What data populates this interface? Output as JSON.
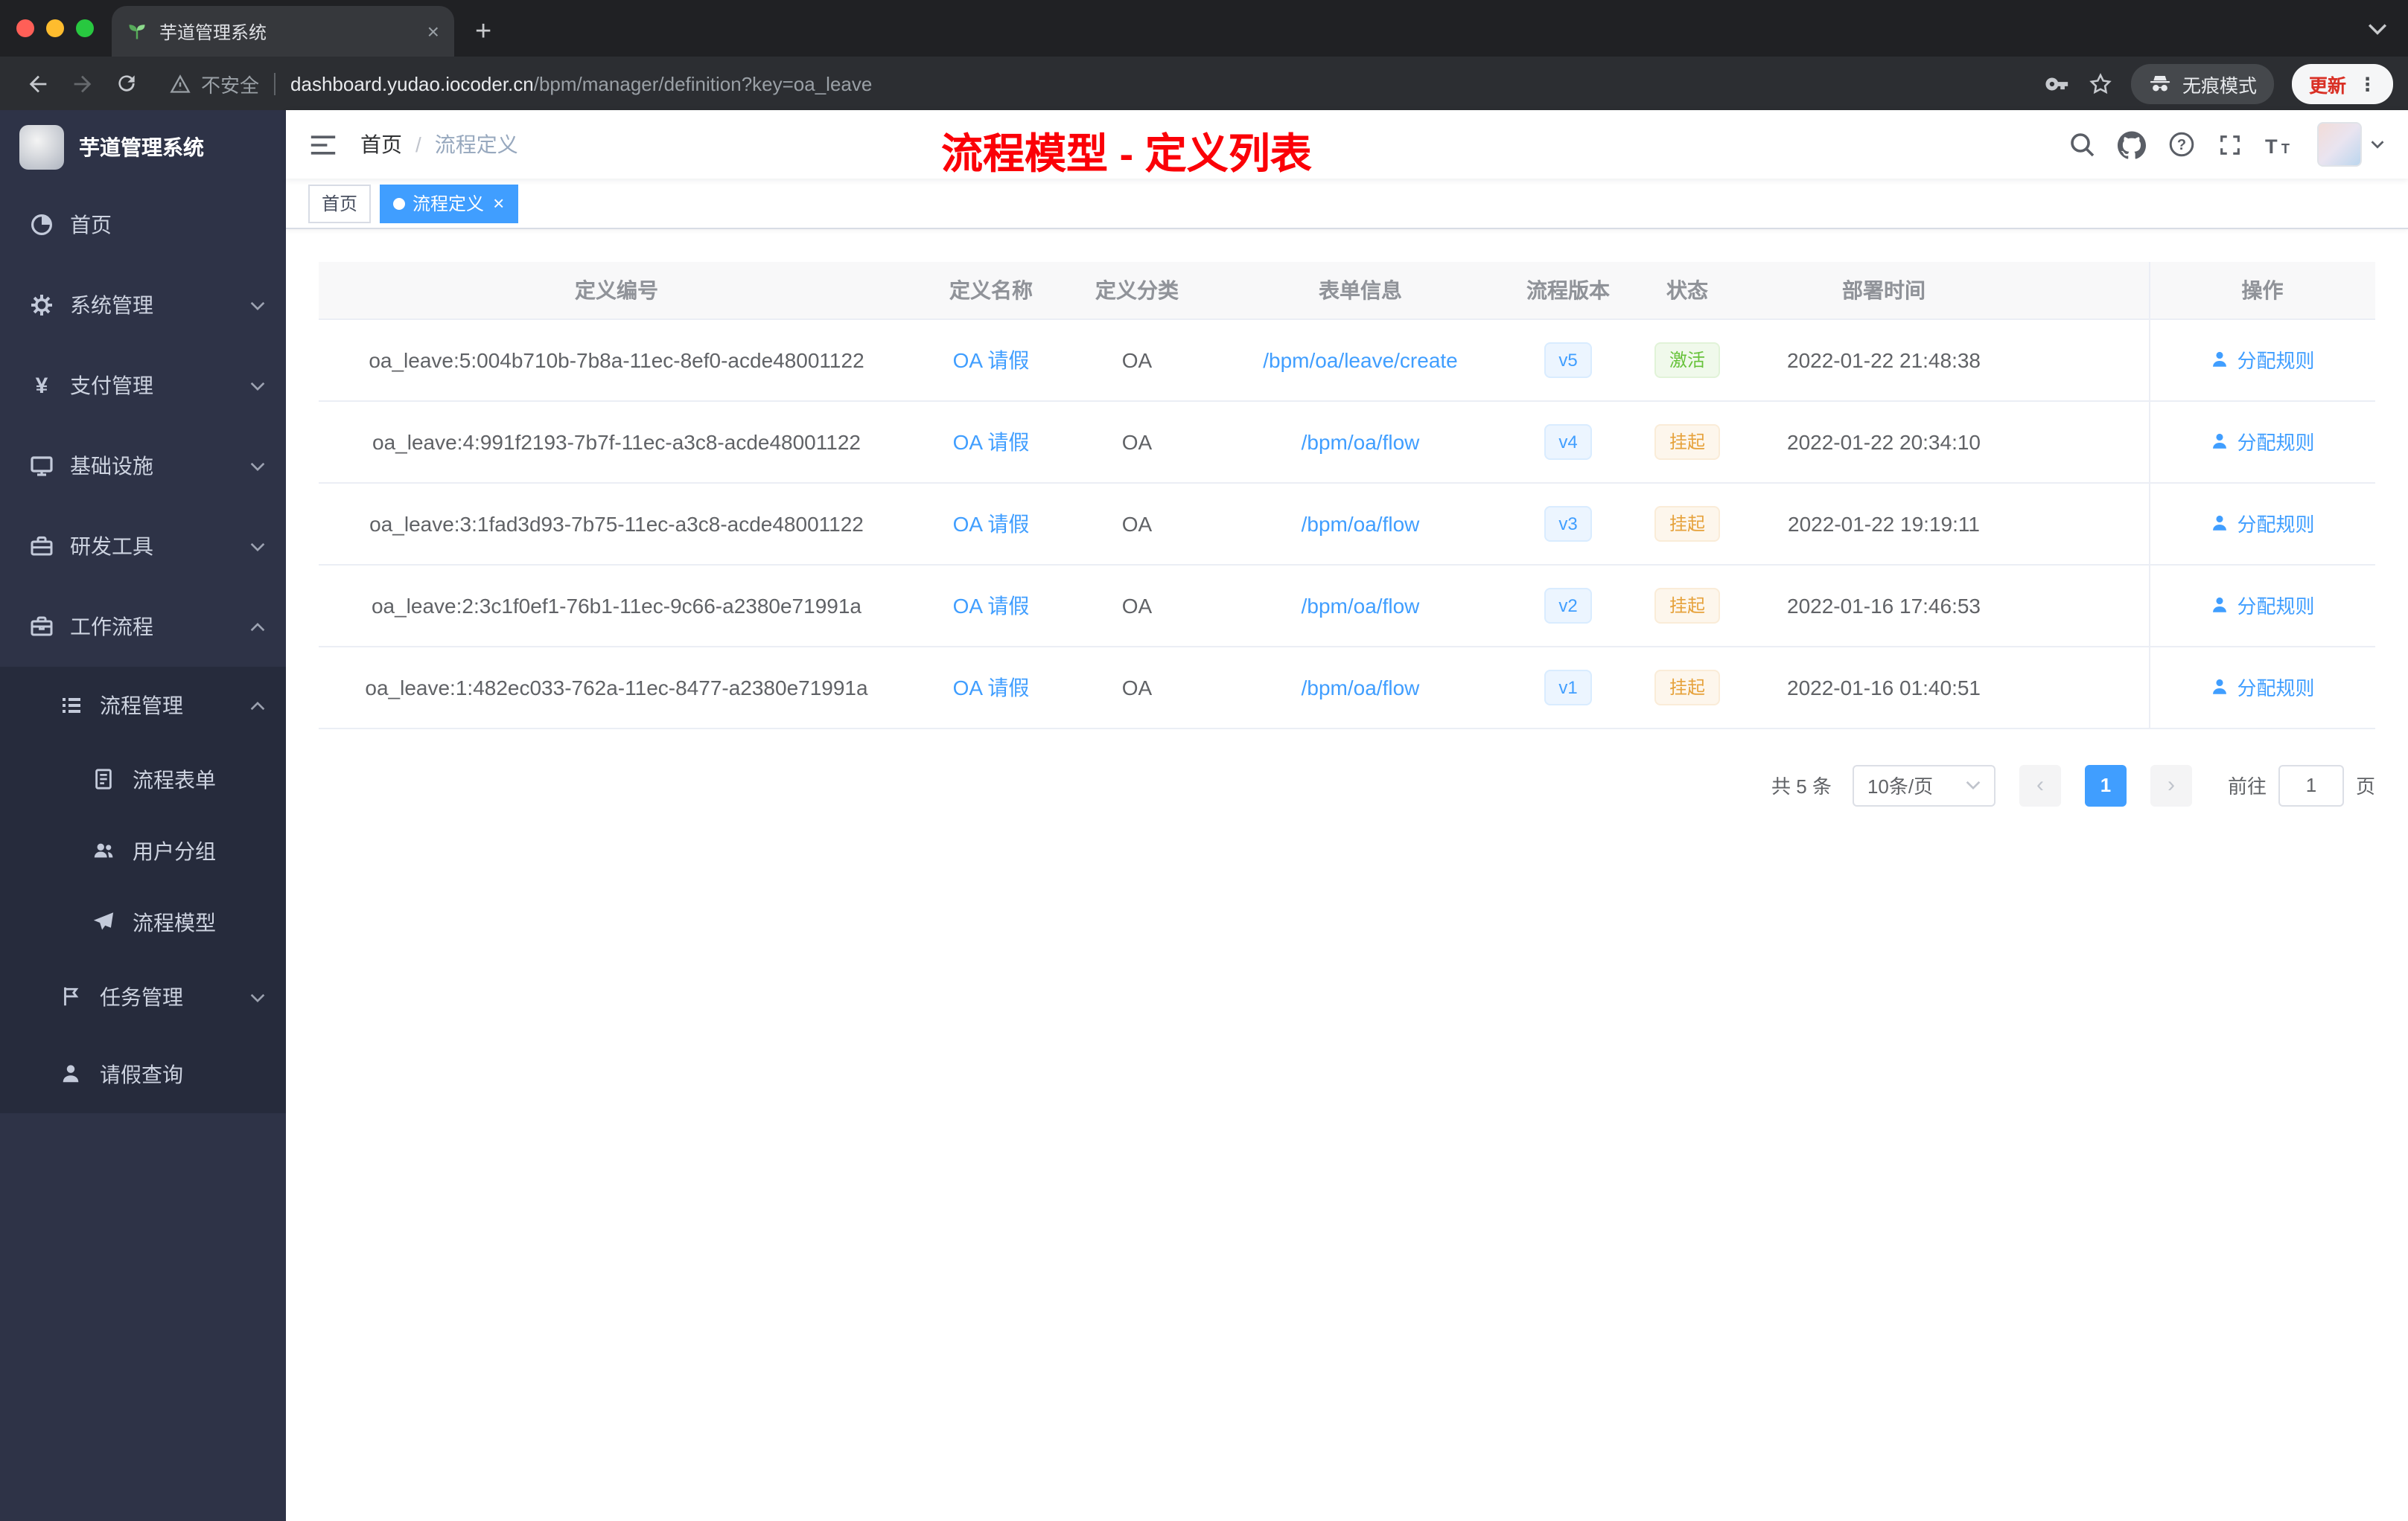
{
  "browser": {
    "tab_title": "芋道管理系统",
    "address": {
      "security_label": "不安全",
      "url_domain": "dashboard.yudao.iocoder.cn",
      "url_path": "/bpm/manager/definition?key=oa_leave",
      "incognito_label": "无痕模式",
      "update_label": "更新"
    }
  },
  "sidebar": {
    "logo_title": "芋道管理系统",
    "items": {
      "home": "首页",
      "system": "系统管理",
      "payment": "支付管理",
      "infra": "基础设施",
      "devtools": "研发工具",
      "workflow": "工作流程",
      "process_mgmt": "流程管理",
      "process_form": "流程表单",
      "user_group": "用户分组",
      "process_model": "流程模型",
      "task_mgmt": "任务管理",
      "leave_query": "请假查询"
    }
  },
  "header": {
    "breadcrumb_home": "首页",
    "breadcrumb_separator": "/",
    "breadcrumb_current": "流程定义",
    "annotation_title": "流程模型 - 定义列表"
  },
  "tags": {
    "home": "首页",
    "active": "流程定义"
  },
  "table": {
    "columns": [
      "定义编号",
      "定义名称",
      "定义分类",
      "表单信息",
      "流程版本",
      "状态",
      "部署时间",
      "操作"
    ],
    "rows": [
      {
        "id": "oa_leave:5:004b710b-7b8a-11ec-8ef0-acde48001122",
        "name": "OA 请假",
        "category": "OA",
        "form": "/bpm/oa/leave/create",
        "version": "v5",
        "status": "激活",
        "status_class": "badge badge-success",
        "time": "2022-01-22 21:48:38",
        "action": "分配规则"
      },
      {
        "id": "oa_leave:4:991f2193-7b7f-11ec-a3c8-acde48001122",
        "name": "OA 请假",
        "category": "OA",
        "form": "/bpm/oa/flow",
        "version": "v4",
        "status": "挂起",
        "status_class": "badge badge-warning",
        "time": "2022-01-22 20:34:10",
        "action": "分配规则"
      },
      {
        "id": "oa_leave:3:1fad3d93-7b75-11ec-a3c8-acde48001122",
        "name": "OA 请假",
        "category": "OA",
        "form": "/bpm/oa/flow",
        "version": "v3",
        "status": "挂起",
        "status_class": "badge badge-warning",
        "time": "2022-01-22 19:19:11",
        "action": "分配规则"
      },
      {
        "id": "oa_leave:2:3c1f0ef1-76b1-11ec-9c66-a2380e71991a",
        "name": "OA 请假",
        "category": "OA",
        "form": "/bpm/oa/flow",
        "version": "v2",
        "status": "挂起",
        "status_class": "badge badge-warning",
        "time": "2022-01-16 17:46:53",
        "action": "分配规则"
      },
      {
        "id": "oa_leave:1:482ec033-762a-11ec-8477-a2380e71991a",
        "name": "OA 请假",
        "category": "OA",
        "form": "/bpm/oa/flow",
        "version": "v1",
        "status": "挂起",
        "status_class": "badge badge-warning",
        "time": "2022-01-16 01:40:51",
        "action": "分配规则"
      }
    ]
  },
  "pagination": {
    "total": "共 5 条",
    "page_size": "10条/页",
    "current_page": "1",
    "goto_label": "前往",
    "goto_value": "1",
    "page_unit": "页"
  },
  "colors": {
    "accent": "#409eff",
    "success_text": "#67c23a",
    "warning_text": "#e6a23c",
    "annotation_red": "#fb0007",
    "sidebar_bg": "#2e3347",
    "submenu_bg": "#262b3c"
  }
}
